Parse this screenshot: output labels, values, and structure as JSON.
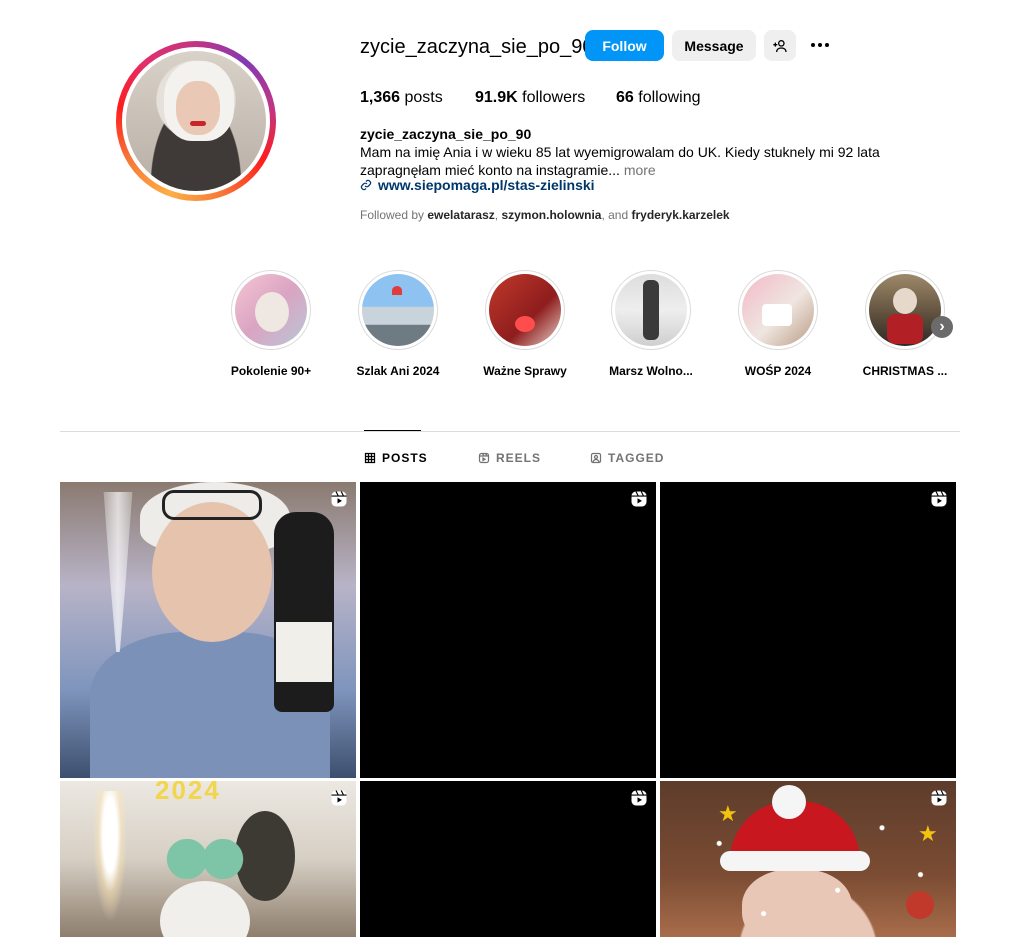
{
  "profile": {
    "username": "zycie_zaczyna_sie_po_90",
    "follow_label": "Follow",
    "message_label": "Message",
    "stats": {
      "posts_count": "1,366",
      "posts_label": "posts",
      "followers_count": "91.9K",
      "followers_label": "followers",
      "following_count": "66",
      "following_label": "following"
    },
    "bio": {
      "name": "zycie_zaczyna_sie_po_90",
      "text": "Mam na imię Ania i w wieku 85 lat wyemigrowalam do UK. Kiedy stuknely mi 92 lata zapragnęłam mieć konto na instagramie...",
      "more_label": "more",
      "link": "www.siepomaga.pl/stas-zielinski"
    },
    "followed_by": {
      "prefix": "Followed by",
      "users": [
        "ewelatarasz",
        "szymon.holownia"
      ],
      "and_text": ", and",
      "last_user": "fryderyk.karzelek"
    }
  },
  "highlights": [
    {
      "label": "Pokolenie 90+"
    },
    {
      "label": "Szlak Ani 2024"
    },
    {
      "label": "Ważne Sprawy"
    },
    {
      "label": "Marsz Wolno..."
    },
    {
      "label": "WOŚP 2024"
    },
    {
      "label": "CHRISTMAS ..."
    }
  ],
  "tabs": [
    {
      "label": "POSTS",
      "active": true,
      "icon": "grid-icon"
    },
    {
      "label": "REELS",
      "active": false,
      "icon": "reels-icon"
    },
    {
      "label": "TAGGED",
      "active": false,
      "icon": "tagged-icon"
    }
  ],
  "grid": {
    "tile_4_overlay_text": "2024"
  },
  "colors": {
    "follow_blue": "#0095f6",
    "link_blue": "#00376b",
    "secondary_text": "#737373",
    "button_gray": "#efefef"
  }
}
